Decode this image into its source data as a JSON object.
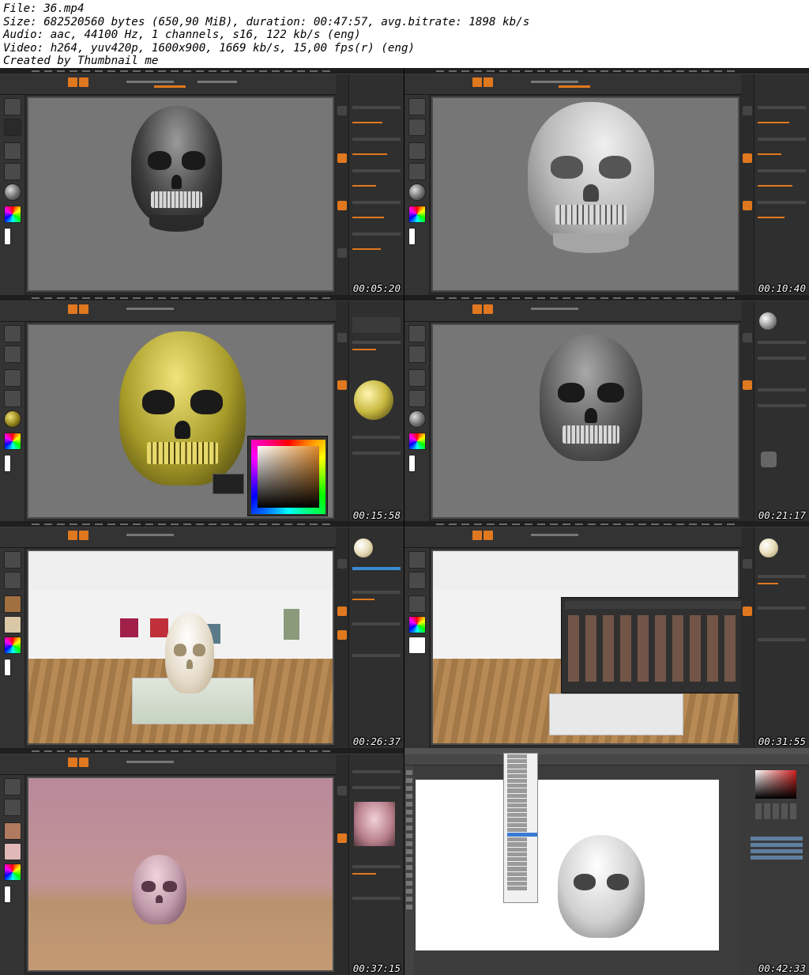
{
  "header": {
    "file": "File: 36.mp4",
    "size": "Size: 682520560 bytes (650,90 MiB), duration: 00:47:57, avg.bitrate: 1898 kb/s",
    "audio": "Audio: aac, 44100 Hz, 1 channels, s16, 122 kb/s (eng)",
    "video": "Video: h264, yuv420p, 1600x900, 1669 kb/s, 15,00 fps(r) (eng)",
    "created": "Created by Thumbnail me"
  },
  "thumbnails": [
    {
      "timestamp": "00:05:20",
      "scene": "zbrush-dark-skull"
    },
    {
      "timestamp": "00:10:40",
      "scene": "zbrush-white-skull"
    },
    {
      "timestamp": "00:15:58",
      "scene": "zbrush-gold-skull-color-picker"
    },
    {
      "timestamp": "00:21:17",
      "scene": "zbrush-grey-skull-lights"
    },
    {
      "timestamp": "00:26:37",
      "scene": "zbrush-gallery-skull"
    },
    {
      "timestamp": "00:31:55",
      "scene": "zbrush-gallery-texture-popup"
    },
    {
      "timestamp": "00:37:15",
      "scene": "zbrush-pink-skull"
    },
    {
      "timestamp": "00:42:33",
      "scene": "photoshop-window-menu"
    }
  ]
}
